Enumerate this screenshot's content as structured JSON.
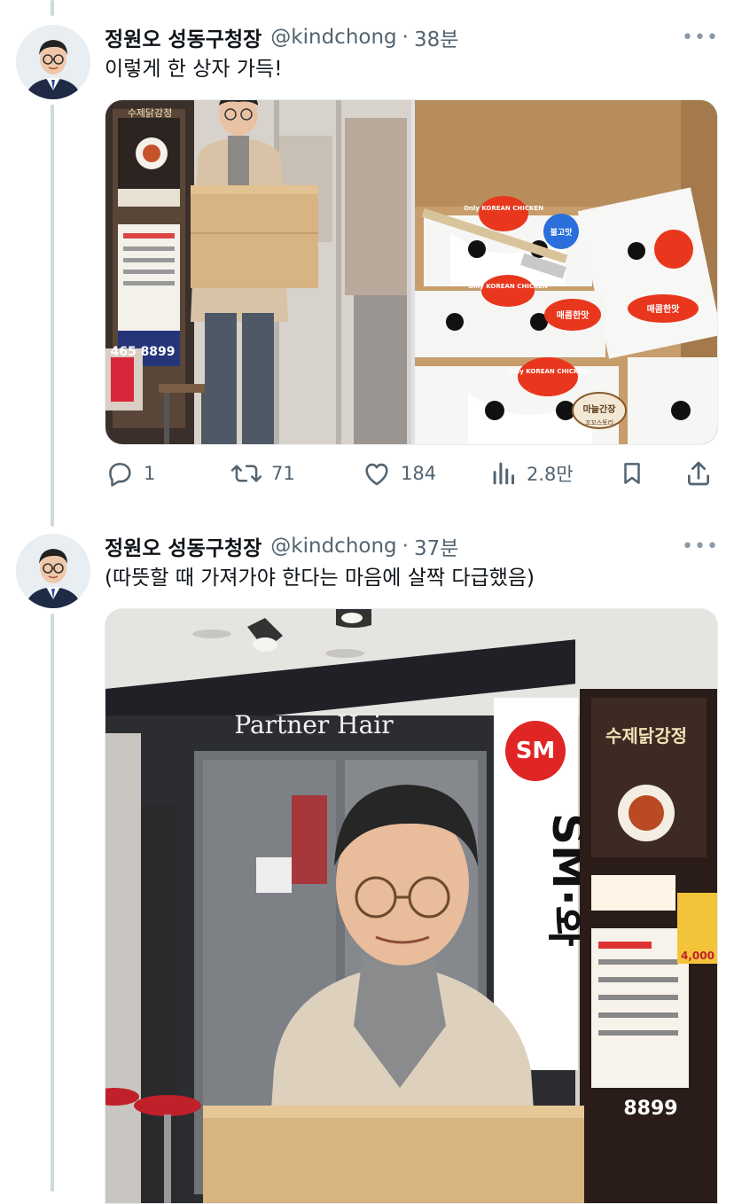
{
  "tweets": [
    {
      "author": "정원오 성동구청장",
      "handle": "@kindchong",
      "separator": "·",
      "time": "38분",
      "text": "이렇게 한 상자 가득!",
      "more": "•••",
      "actions": {
        "reply": "1",
        "retweet": "71",
        "like": "184",
        "views": "2.8만"
      },
      "photos": {
        "left": {
          "poster_title": "수제닭강정",
          "sign_number": "465 8899"
        },
        "right": {
          "box_label_1": "Only KOREAN CHICKEN",
          "box_label_2": "Only KOREAN CHICKEN",
          "box_label_3": "Only KOREAN CHICKEN",
          "sticker_1": "불고맛",
          "sticker_2": "매콤한맛",
          "sticker_3": "마늘간장",
          "sticker_4": "매콤한맛",
          "brand": "꼬꼬스토리"
        }
      }
    },
    {
      "author": "정원오 성동구청장",
      "handle": "@kindchong",
      "separator": "·",
      "time": "37분",
      "text": "(따뜻할 때 가져가야 한다는 마음에 살짝 다급했음)",
      "more": "•••",
      "photo": {
        "salon_sign": "Partner Hair",
        "sm_banner": "SM·화",
        "poster_title": "수제닭강정",
        "price_tag": "4,000",
        "phone_suffix": "8899"
      }
    }
  ],
  "colors": {
    "text": "#0f1419",
    "secondary": "#536471",
    "thread_line": "#cfd9de",
    "accent_red": "#e8371d"
  }
}
